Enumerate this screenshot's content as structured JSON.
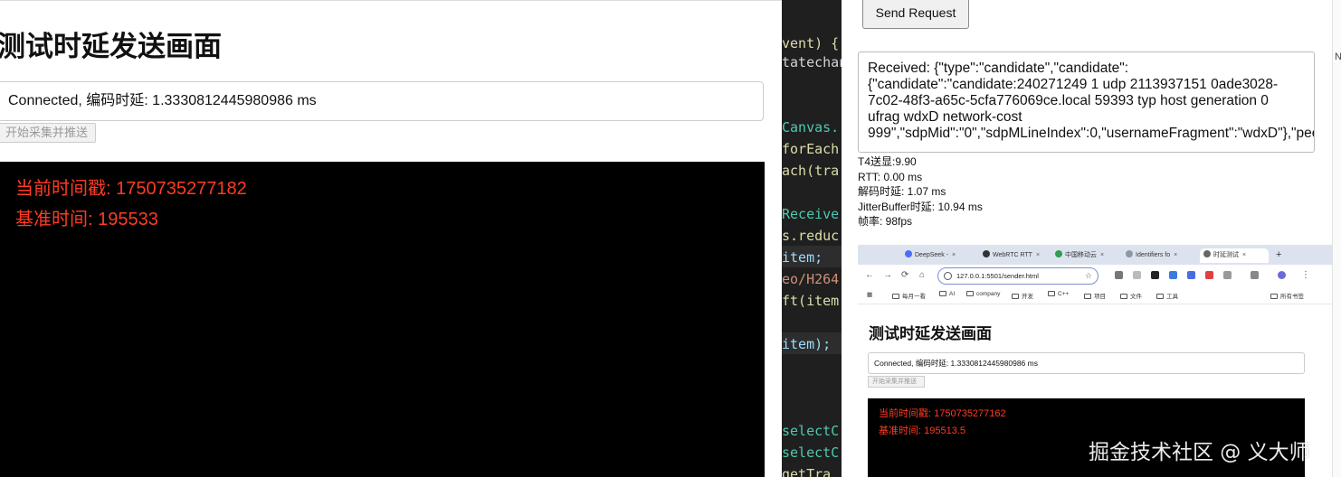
{
  "sender": {
    "title": "测试时延发送画面",
    "status": "Connected, 编码时延: 1.3330812445980986 ms",
    "start_button": "开始采集并推送",
    "overlay": {
      "timestamp": "当前时间戳: 1750735277182",
      "base_time": "基准时间: 195533"
    }
  },
  "editor": {
    "lines": [
      {
        "text": "vent) {",
        "color": "#dcdcaa"
      },
      {
        "text": "tatechan",
        "color": "#d4d4d4"
      },
      {
        "text": "Canvas.",
        "color": "#4ec9b0"
      },
      {
        "text": "forEach(",
        "color": "#dcdcaa"
      },
      {
        "text": "ach(tra",
        "color": "#dcdcaa"
      },
      {
        "text": "Receive",
        "color": "#4ec9b0"
      },
      {
        "text": "s.reduc",
        "color": "#dcdcaa"
      },
      {
        "text": "item; ",
        "color": "#9cdcfe"
      },
      {
        "text": "eo/H264",
        "color": "#ce9178"
      },
      {
        "text": "ft(item",
        "color": "#dcdcaa"
      },
      {
        "text": "item);",
        "color": "#9cdcfe"
      },
      {
        "text": "selectC",
        "color": "#4ec9b0"
      },
      {
        "text": "selectC",
        "color": "#4ec9b0"
      },
      {
        "text": "getTra",
        "color": "#dcdcaa"
      }
    ]
  },
  "receiver": {
    "send_button": "Send Request",
    "edge_letter": "N",
    "received_lines": [
      "Received: {\"type\":\"candidate\",\"candidate\":",
      "{\"candidate\":\"candidate:240271249 1 udp 2113937151 0ade3028-",
      "7c02-48f3-a65c-5cfa776069ce.local 59393 typ host generation 0",
      "ufrag wdxD network-cost",
      "999\",\"sdpMid\":\"0\",\"sdpMLineIndex\":0,\"usernameFragment\":\"wdxD\"},\"peer"
    ],
    "stats": [
      "T4送显:9.90",
      "RTT: 0.00 ms",
      "解码时延: 1.07 ms",
      "JitterBuffer时延: 10.94 ms",
      "帧率: 98fps"
    ]
  },
  "nested_browser": {
    "tabs": [
      {
        "label": "DeepSeek -",
        "color": "#4d6bfe"
      },
      {
        "label": "WebRTC RTT",
        "color": "#333333"
      },
      {
        "label": "中国移动云",
        "color": "#2e9e4f"
      },
      {
        "label": "Identifiers fo",
        "color": "#8899aa"
      },
      {
        "label": "时延测试",
        "color": "#444444"
      }
    ],
    "url": "127.0.0.1:5501/sender.html",
    "bookmarks": [
      "每月一看",
      "AI",
      "company",
      "开发",
      "C++",
      "项目",
      "文件",
      "工具",
      "所有书签"
    ],
    "page": {
      "title": "测试时延发送画面",
      "status": "Connected, 编码时延: 1.3330812445980986 ms",
      "start_button": "开始采集并推送",
      "timestamp": "当前时间戳: 1750735277162",
      "base_time": "基准时间: 195513.5"
    }
  },
  "watermark": "掘金技术社区 @ 义大师"
}
